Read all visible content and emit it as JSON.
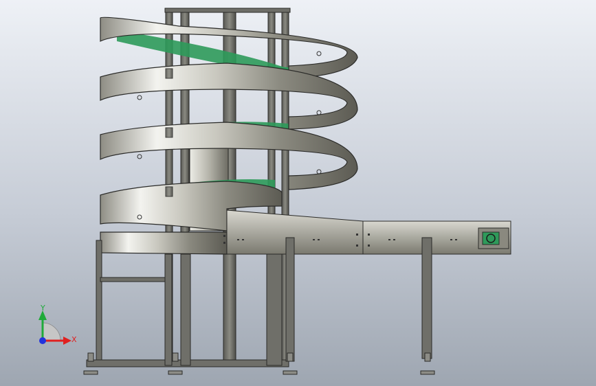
{
  "triad": {
    "x_label": "X",
    "y_label": "Y",
    "x_color": "#e02020",
    "y_color": "#1faa3a",
    "z_color": "#2233dd"
  },
  "colors": {
    "steel_light": "#f2f2ee",
    "steel_mid": "#b9b8ad",
    "steel_dark": "#5e5d55",
    "frame": "#6b6b66",
    "belt": "#2e9a5a",
    "outline": "#2a2a28"
  }
}
